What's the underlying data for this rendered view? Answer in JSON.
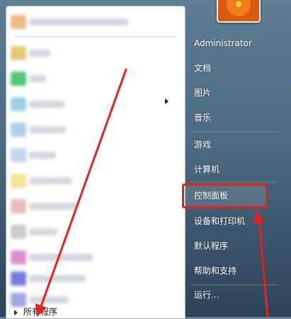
{
  "start_menu": {
    "left_pane": {
      "pinned": [
        {
          "icon_color": "#e8b27a",
          "label_width": 40
        },
        {
          "icon_color": "#e3c46a",
          "label_width": 30
        }
      ],
      "recent": [
        {
          "icon_color": "#3fbf6a"
        },
        {
          "icon_color": "#8fcde0"
        },
        {
          "icon_color": "#a9c8e8"
        },
        {
          "icon_color": "#b9d3ea"
        },
        {
          "icon_color": "#f1e08a"
        },
        {
          "icon_color": "#e6b5b5"
        },
        {
          "icon_color": "#c7c7c7"
        },
        {
          "icon_color": "#d983c8"
        },
        {
          "icon_color": "#6a6fd8"
        },
        {
          "icon_color": "#9a9ee0"
        }
      ],
      "all_programs_label": "所有程序"
    },
    "right_pane": {
      "user_name": "Administrator",
      "items": [
        "文档",
        "图片",
        "音乐",
        "游戏",
        "计算机",
        "控制面板",
        "设备和打印机",
        "默认程序",
        "帮助和支持",
        "运行..."
      ]
    }
  },
  "annotation": {
    "highlight_color": "#e0231f",
    "highlighted_item": "控制面板"
  }
}
